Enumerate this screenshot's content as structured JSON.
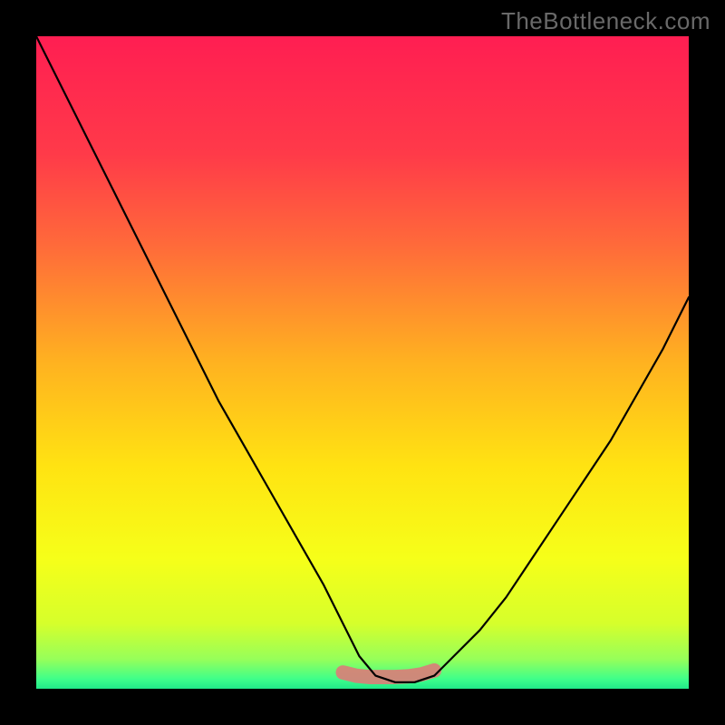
{
  "attribution": "TheBottleneck.com",
  "chart_data": {
    "type": "line",
    "title": "",
    "xlabel": "",
    "ylabel": "",
    "xlim": [
      0,
      100
    ],
    "ylim": [
      0,
      100
    ],
    "gradient_stops": [
      {
        "offset": 0.0,
        "color": "#ff1e52"
      },
      {
        "offset": 0.18,
        "color": "#ff3a49"
      },
      {
        "offset": 0.32,
        "color": "#ff6a3a"
      },
      {
        "offset": 0.5,
        "color": "#ffb220"
      },
      {
        "offset": 0.66,
        "color": "#ffe312"
      },
      {
        "offset": 0.8,
        "color": "#f6ff19"
      },
      {
        "offset": 0.9,
        "color": "#d6ff2b"
      },
      {
        "offset": 0.955,
        "color": "#96ff5a"
      },
      {
        "offset": 0.985,
        "color": "#3fff8a"
      },
      {
        "offset": 1.0,
        "color": "#21e889"
      }
    ],
    "series": [
      {
        "name": "curve",
        "x": [
          0,
          4,
          8,
          12,
          16,
          20,
          24,
          28,
          32,
          36,
          40,
          44,
          47,
          49.5,
          52,
          55,
          58,
          61,
          64,
          68,
          72,
          76,
          80,
          84,
          88,
          92,
          96,
          100
        ],
        "values": [
          100,
          92,
          84,
          76,
          68,
          60,
          52,
          44,
          37,
          30,
          23,
          16,
          10,
          5,
          2,
          1,
          1,
          2,
          5,
          9,
          14,
          20,
          26,
          32,
          38,
          45,
          52,
          60
        ]
      },
      {
        "name": "floor-segment",
        "x": [
          47,
          49,
          51,
          53,
          55,
          57,
          59,
          61
        ],
        "values": [
          2.5,
          2.0,
          1.8,
          1.8,
          1.8,
          1.9,
          2.2,
          2.8
        ]
      }
    ],
    "floor_color": "#d97f78",
    "floor_thickness_pct": 2.2,
    "curve_color": "#000000"
  }
}
